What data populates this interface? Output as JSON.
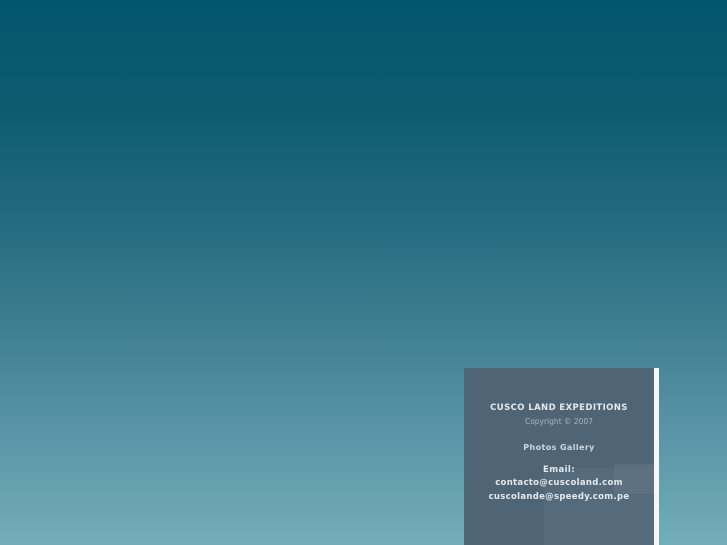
{
  "footer": {
    "company_name": "CUSCO LAND EXPEDITIONS",
    "copyright": "Copyright © 2007",
    "gallery_link": "Photos Gallery",
    "email_label": "Email:",
    "emails": [
      "contacto@cuscoland.com",
      "cuscolande@speedy.com.pe"
    ]
  },
  "colors": {
    "background_top": "#02566d",
    "background_bottom": "#74adba",
    "panel": "#4f6576",
    "panel_text": "#e4e9ed"
  }
}
